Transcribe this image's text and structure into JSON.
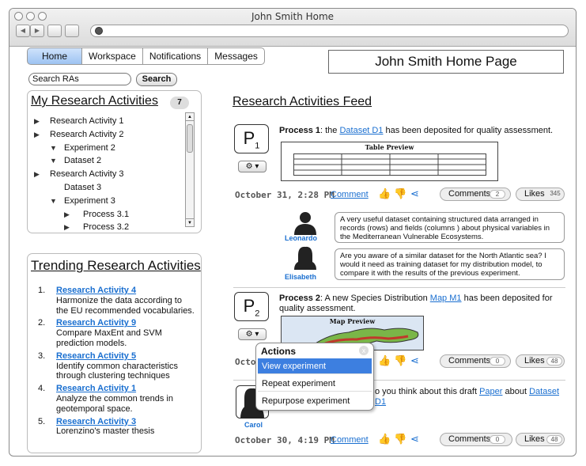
{
  "window": {
    "title": "John Smith Home"
  },
  "tabs": [
    "Home",
    "Workspace",
    "Notifications",
    "Messages"
  ],
  "page_title": "John Smith Home Page",
  "search": {
    "value": "Search RAs",
    "button": "Search"
  },
  "my_research": {
    "title": "My Research Activities",
    "count": "7",
    "items": [
      {
        "label": "Research Activity 1",
        "level": 0,
        "marker": "collapsed"
      },
      {
        "label": "Research Activity 2",
        "level": 0,
        "marker": "collapsed"
      },
      {
        "label": "Experiment 2",
        "level": 1,
        "marker": "expanded"
      },
      {
        "label": "Dataset 2",
        "level": 1,
        "marker": "expanded"
      },
      {
        "label": "Research Activity 3",
        "level": 0,
        "marker": "collapsed"
      },
      {
        "label": "Dataset 3",
        "level": 1,
        "marker": "none"
      },
      {
        "label": "Experiment 3",
        "level": 1,
        "marker": "expanded"
      },
      {
        "label": "Process 3.1",
        "level": 2,
        "marker": "collapsed"
      },
      {
        "label": "Process 3.2",
        "level": 2,
        "marker": "collapsed"
      }
    ]
  },
  "trending": {
    "title": "Trending Research Activities",
    "items": [
      {
        "num": "1.",
        "link": "Research Activity 4",
        "desc": "Harmonize the data according to the EU recommended vocabularies."
      },
      {
        "num": "2.",
        "link": "Research Activity 9",
        "desc": "Compare MaxEnt and SVM prediction models."
      },
      {
        "num": "3.",
        "link": "Research Activity 5",
        "desc": "Identify common characteristics through clustering techniques"
      },
      {
        "num": "4.",
        "link": "Research Activity 1",
        "desc": "Analyze the common trends in geotemporal space."
      },
      {
        "num": "5.",
        "link": "Research Activity 3",
        "desc": "Lorenzino's master thesis"
      }
    ]
  },
  "feed": {
    "title": "Research Activities Feed",
    "post1": {
      "badge": "P",
      "badge_sub": "1",
      "bold": "Process 1",
      "text_a": ":  the ",
      "link": "Dataset D1",
      "text_b": " has been deposited for quality assessment.",
      "preview_title": "Table Preview",
      "date": "October 31, 2:28 PM",
      "comment_link": "Comment",
      "comments_label": "Comments",
      "comments_count": "2",
      "likes_label": "Likes",
      "likes_count": "345"
    },
    "comments": [
      {
        "user": "Leonardo",
        "text": "A very useful dataset containing structured data arranged in records (rows) and fields (columns ) about physical variables in the Mediterranean Vulnerable Ecosystems."
      },
      {
        "user": "Elisabeth",
        "text": "Are you aware of a similar dataset for the North Atlantic sea? I would it need as training dataset for my distribution model, to compare it with the results of the previous experiment."
      }
    ],
    "post2": {
      "badge": "P",
      "badge_sub": "2",
      "bold": "Process 2",
      "text_a": ":  A new Species Distribution ",
      "link": "Map M1",
      "text_b": " has been deposited for quality assessment.",
      "preview_title": "Map Preview",
      "date_partial": "Octo",
      "comments_label": "Comments",
      "comments_count": "0",
      "likes_label": "Likes",
      "likes_count": "48"
    },
    "post3": {
      "user": "Carol",
      "text_a": "o you think about this draft ",
      "link1": "Paper",
      "text_b": " about ",
      "link2": "Dataset D1",
      "date": "October 30, 4:19 PM",
      "comment_link": "Comment",
      "comments_label": "Comments",
      "comments_count": "0",
      "likes_label": "Likes",
      "likes_count": "48"
    }
  },
  "actions_menu": {
    "title": "Actions",
    "close": "x",
    "items": [
      "View experiment",
      "Repeat experiment",
      "Repurpose experiment"
    ]
  },
  "colors": {
    "link": "#1a6fd0",
    "tab_active": "#9dc3f2",
    "menu_selected": "#3d7fe0"
  }
}
